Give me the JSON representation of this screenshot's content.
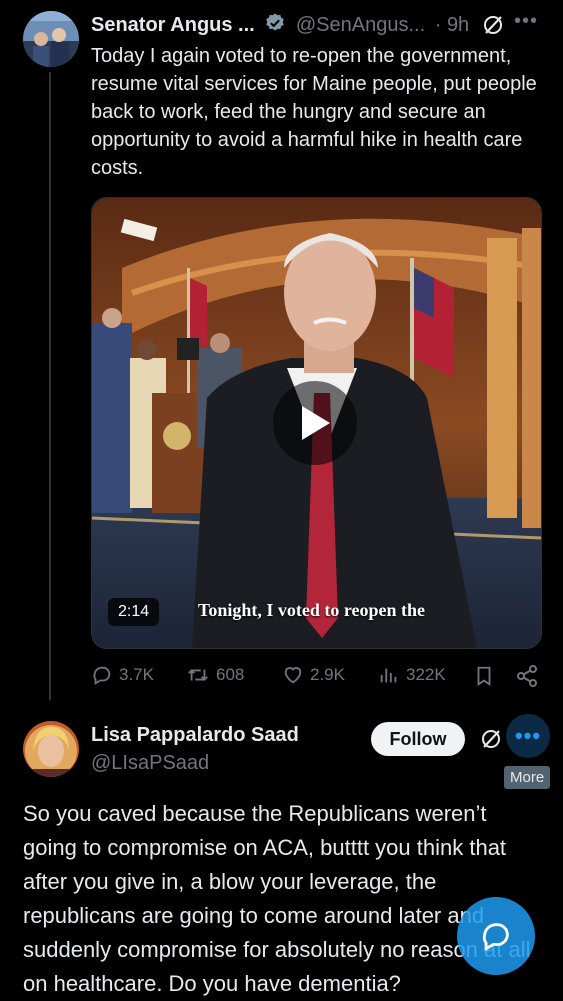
{
  "tweet": {
    "author_name": "Senator Angus ...",
    "handle": "@SenAngus...",
    "separator": "·",
    "time": "9h",
    "text": "Today I again voted to re-open the government, resume vital services for Maine people, put people back to work, feed the hungry and secure an opportunity to avoid a harmful hike in health care costs.",
    "video": {
      "duration": "2:14",
      "caption": "Tonight, I voted to reopen the"
    },
    "stats": {
      "replies": "3.7K",
      "retweets": "608",
      "likes": "2.9K",
      "views": "322K"
    }
  },
  "reply": {
    "author_name": "Lisa Pappalardo Saad",
    "handle": "@LIsaPSaad",
    "follow_label": "Follow",
    "more_icon": "•••",
    "tooltip": "More",
    "text": "So you caved because the Republicans weren’t going to compromise on ACA, butttt you think that after you give in, a blow your leverage, the republicans are going to come around later and suddenly compromise for absolutely no reason at all on healthcare. Do you have dementia?"
  },
  "colors": {
    "background": "#000000",
    "text": "#e7e9ea",
    "secondary": "#71767b",
    "accent": "#1d9bf0",
    "verified_badge": "#829aab"
  }
}
